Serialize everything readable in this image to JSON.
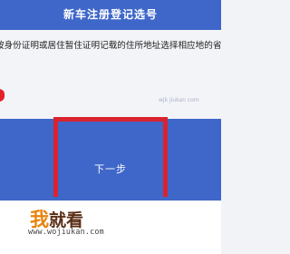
{
  "header": {
    "title": "新车注册登记选号"
  },
  "instruction": {
    "text": "按身份证明或居住暂住证明记载的住所地址选择相应地的省"
  },
  "watermark": {
    "small_text": "wjk jiukan com"
  },
  "actions": {
    "next_label": "下一步"
  },
  "logo": {
    "char1": "我",
    "rest": "就看",
    "url": "www.wojiukan.com"
  },
  "colors": {
    "header": "#3f67c9",
    "highlight": "#d9232f",
    "mark": "#e5202a"
  }
}
